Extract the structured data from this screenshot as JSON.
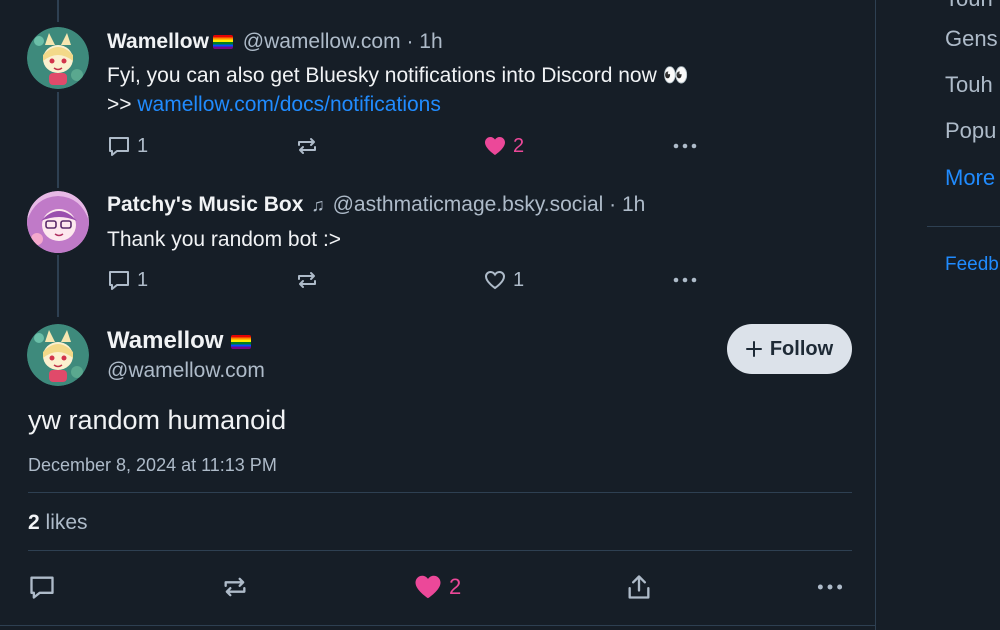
{
  "thread": [
    {
      "name": "Wamellow",
      "handle": "@wamellow.com",
      "time": "· 1h",
      "text_line1": "Fyi, you can also get Bluesky notifications into Discord now 👀",
      "text_prefix": ">> ",
      "link": "wamellow.com/docs/notifications",
      "replies": "1",
      "likes": "2",
      "liked": true
    },
    {
      "name": "Patchy's Music Box",
      "handle": "@asthmaticmage.bsky.social",
      "time": "· 1h",
      "text_line1": "Thank you random bot :>",
      "replies": "1",
      "likes": "1",
      "liked": false
    }
  ],
  "focus": {
    "name": "Wamellow",
    "handle": "@wamellow.com",
    "follow_label": "Follow",
    "text": "yw random humanoid",
    "timestamp": "December 8, 2024 at 11:13 PM",
    "likes_count": "2",
    "likes_label": " likes",
    "action_likes": "2"
  },
  "sidebar": {
    "items": [
      "Touh",
      "Gens",
      "Touh",
      "Popu"
    ],
    "more": "More",
    "feedback": "Feedb"
  },
  "colors": {
    "accent": "#208bfe",
    "like": "#ec4899",
    "background": "#161e27"
  },
  "icons": [
    "reply-icon",
    "repost-icon",
    "heart-icon",
    "more-icon",
    "share-icon",
    "plus-icon"
  ]
}
